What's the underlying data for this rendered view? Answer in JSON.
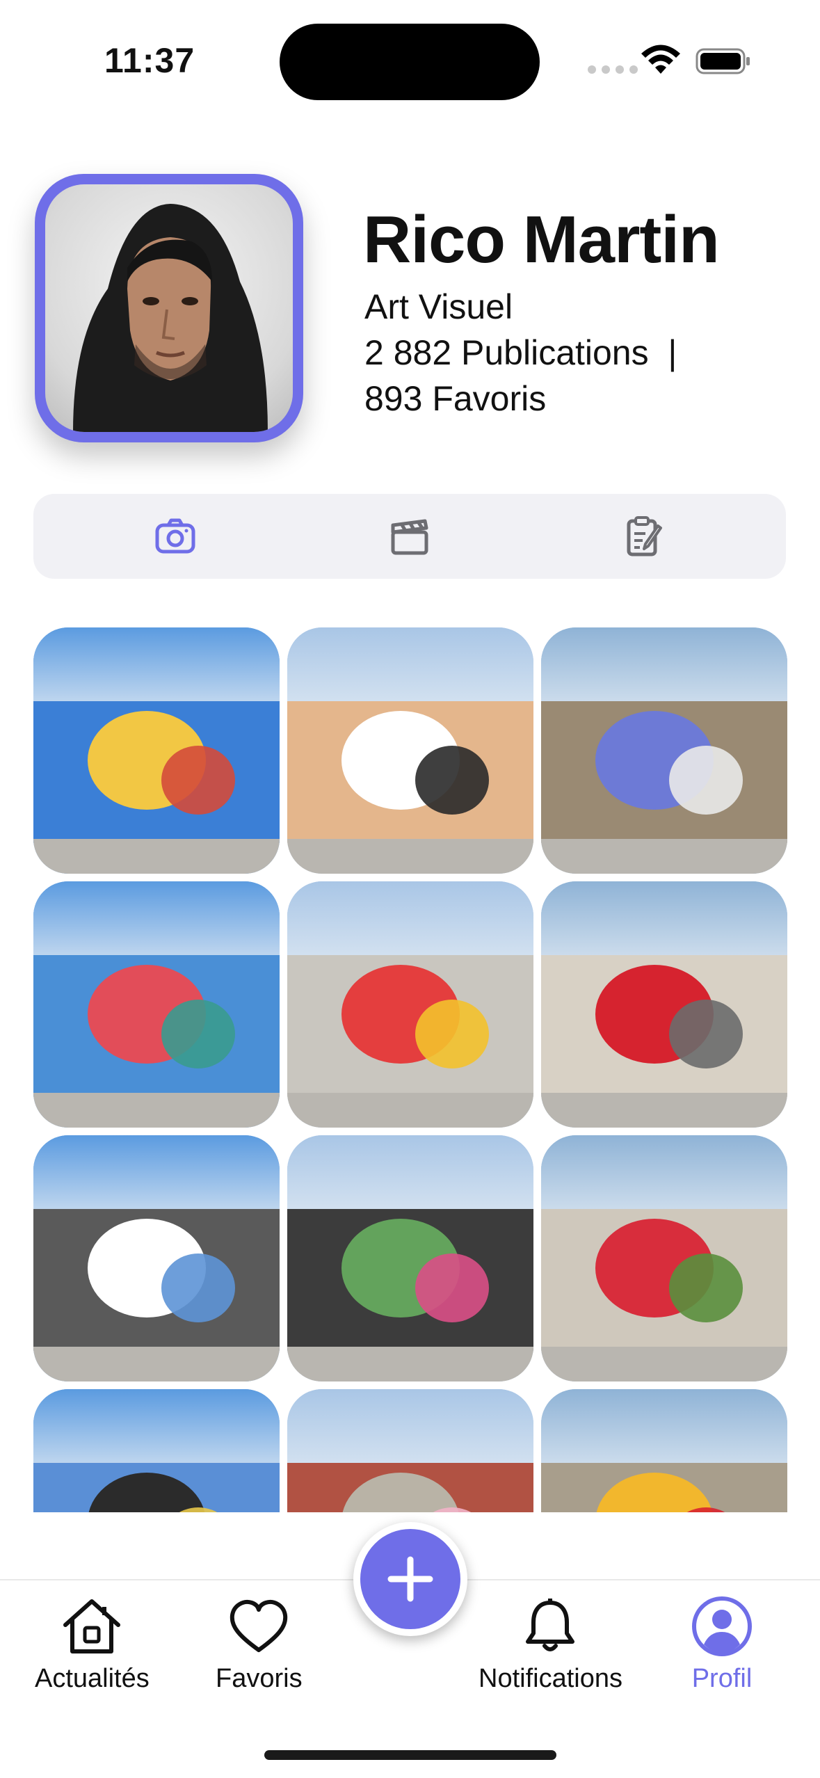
{
  "status_bar": {
    "time": "11:37"
  },
  "profile": {
    "name": "Rico Martin",
    "category": "Art Visuel",
    "publications": "2 882 Publications  |",
    "favorites": "893 Favoris"
  },
  "tabs": [
    {
      "icon": "camera-icon",
      "active": true
    },
    {
      "icon": "clapperboard-icon",
      "active": false
    },
    {
      "icon": "clipboard-edit-icon",
      "active": false
    }
  ],
  "grid": {
    "tiles": [
      {
        "description_colors": [
          "#3b7fd6",
          "#f2c744",
          "#d44b3b"
        ]
      },
      {
        "description_colors": [
          "#e4b68c",
          "#ffffff",
          "#2a2a2a"
        ]
      },
      {
        "description_colors": [
          "#9a8a73",
          "#6d7ad6",
          "#e9e9e9"
        ]
      },
      {
        "description_colors": [
          "#4a8fd6",
          "#e24d59",
          "#3a9b8f"
        ]
      },
      {
        "description_colors": [
          "#c9c6bf",
          "#e43e3e",
          "#f3c12c"
        ]
      },
      {
        "description_colors": [
          "#d8d1c5",
          "#d6232f",
          "#6c6c6c"
        ]
      },
      {
        "description_colors": [
          "#5a5a5a",
          "#ffffff",
          "#5d93d6"
        ]
      },
      {
        "description_colors": [
          "#3c3c3c",
          "#63a35c",
          "#d94f86"
        ]
      },
      {
        "description_colors": [
          "#cfc8bc",
          "#d82d3c",
          "#5a8f3d"
        ]
      },
      {
        "description_colors": [
          "#5a8fd6",
          "#2b2b2b",
          "#e8c84a"
        ]
      },
      {
        "description_colors": [
          "#b15243",
          "#b9b3a6",
          "#f2b3c8"
        ]
      },
      {
        "description_colors": [
          "#a89e8c",
          "#f2b72d",
          "#d8232f"
        ]
      }
    ]
  },
  "nav": {
    "news": "Actualités",
    "favorites": "Favoris",
    "notifications": "Notifications",
    "profile": "Profil"
  },
  "colors": {
    "accent": "#6f6ee8",
    "tab_background": "#f1f1f5"
  }
}
